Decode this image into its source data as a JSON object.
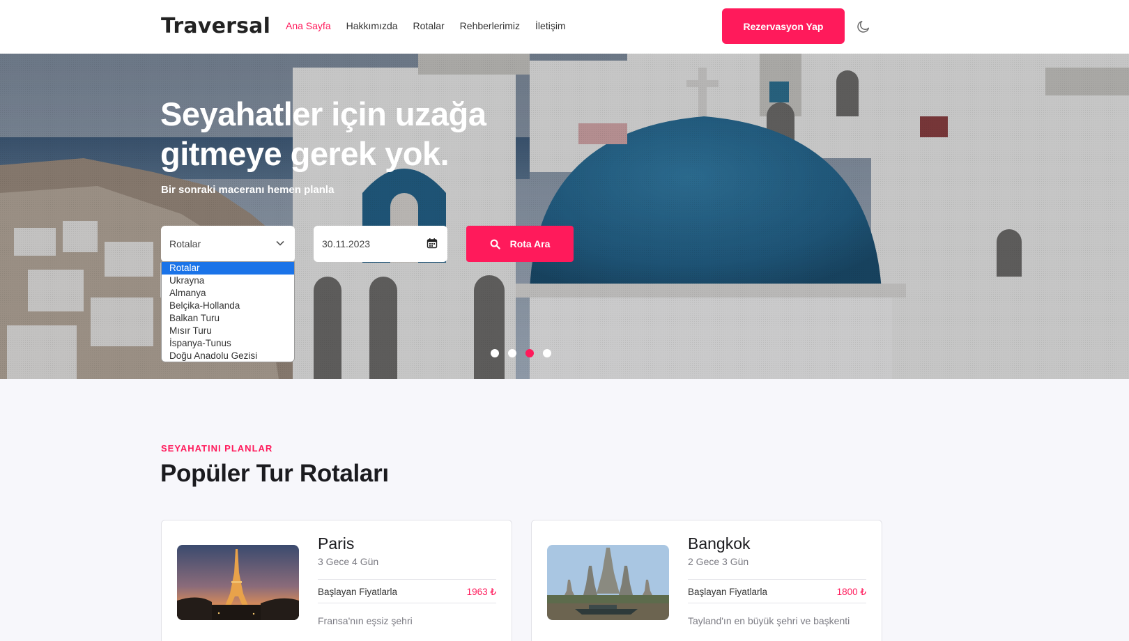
{
  "header": {
    "logo": "Traversal",
    "nav": [
      {
        "label": "Ana Sayfa",
        "active": true
      },
      {
        "label": "Hakkımızda",
        "active": false
      },
      {
        "label": "Rotalar",
        "active": false
      },
      {
        "label": "Rehberlerimiz",
        "active": false
      },
      {
        "label": "İletişim",
        "active": false
      }
    ],
    "reserve_label": "Rezervasyon Yap",
    "theme_icon": "moon-icon"
  },
  "hero": {
    "title_line1": "Seyahatler için uzağa",
    "title_line2": "gitmeye gerek yok.",
    "subtitle": "Bir sonraki maceranı hemen planla",
    "route_select": {
      "value": "Rotalar",
      "options": [
        "Rotalar",
        "Ukrayna",
        "Almanya",
        "Belçika-Hollanda",
        "Balkan Turu",
        "Mısır Turu",
        "İspanya-Tunus",
        "Doğu Anadolu Gezisi"
      ],
      "selected_index": 0
    },
    "date_value": "30.11.2023",
    "search_label": "Rota Ara",
    "slides": {
      "count": 4,
      "active_index": 2
    }
  },
  "section": {
    "eyebrow": "SEYAHATINI PLANLAR",
    "title": "Popüler Tur Rotaları"
  },
  "tours": [
    {
      "city": "Paris",
      "duration": "3 Gece 4 Gün",
      "price_label": "Başlayan Fiyatlarla",
      "price": "1963 ₺",
      "description": "Fransa'nın eşsiz şehri"
    },
    {
      "city": "Bangkok",
      "duration": "2 Gece 3 Gün",
      "price_label": "Başlayan Fiyatlarla",
      "price": "1800 ₺",
      "description": "Tayland'ın en büyük şehri ve başkenti"
    }
  ],
  "colors": {
    "accent": "#ff1a5b",
    "dropdown_highlight": "#1a73e8",
    "dome_blue": "#1f5f86"
  }
}
